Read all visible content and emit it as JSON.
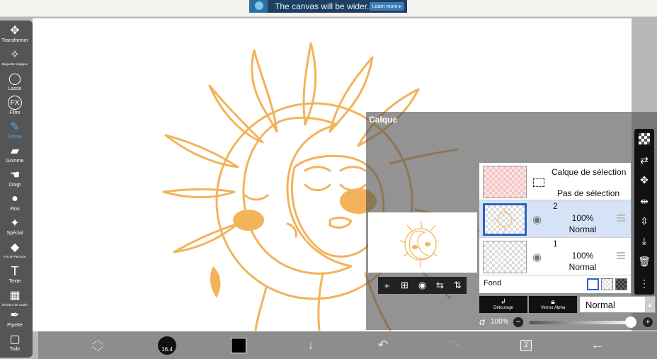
{
  "ad": {
    "text": "The canvas will be wider.",
    "button": "Learn more ▸"
  },
  "toolbar": {
    "tools": [
      {
        "label": "Transformer",
        "icon": "move-icon",
        "glyph": "✥"
      },
      {
        "label": "Baguette Magique",
        "icon": "magic-wand-icon",
        "glyph": "✧"
      },
      {
        "label": "Lasso",
        "icon": "lasso-icon",
        "glyph": "◯"
      },
      {
        "label": "Filtre",
        "icon": "fx-icon",
        "glyph": "FX"
      },
      {
        "label": "Forme",
        "icon": "brush-icon",
        "glyph": "✎"
      },
      {
        "label": "Gomme",
        "icon": "eraser-icon",
        "glyph": "▰"
      },
      {
        "label": "Doigt",
        "icon": "finger-icon",
        "glyph": "☚"
      },
      {
        "label": "Flou",
        "icon": "blur-drop-icon",
        "glyph": "💧"
      },
      {
        "label": "Spécial",
        "icon": "special-icon",
        "glyph": "✦"
      },
      {
        "label": "Pot de Peinture",
        "icon": "paint-bucket-icon",
        "glyph": "◆"
      },
      {
        "label": "Texte",
        "icon": "text-icon",
        "glyph": "T"
      },
      {
        "label": "Diviseur de Cadre",
        "icon": "frame-divider-icon",
        "glyph": "▦"
      },
      {
        "label": "Pipette",
        "icon": "eyedropper-icon",
        "glyph": "✒"
      },
      {
        "label": "Toile",
        "icon": "canvas-icon",
        "glyph": "▢"
      }
    ],
    "active": "Forme"
  },
  "bottombar": {
    "brush_size": "16.4",
    "page_count": "2"
  },
  "panel": {
    "title": "Calque",
    "selection_layer": {
      "title": "Calque de sélection",
      "status": "Pas de sélection"
    },
    "layers": [
      {
        "number": "2",
        "opacity": "100%",
        "mode": "Normal",
        "selected": true
      },
      {
        "number": "1",
        "opacity": "100%",
        "mode": "Normal",
        "selected": false
      }
    ],
    "fond_label": "Fond",
    "blend_buttons": {
      "clipping": "Détourage",
      "alpha_lock": "Verrou Alpha"
    },
    "blend_mode": "Normal",
    "alpha_symbol": "α",
    "alpha_value": "100%"
  },
  "colors": {
    "sun": "#f2b35a",
    "accent_blue": "#2b63c4",
    "panel_dark": "#111111"
  }
}
